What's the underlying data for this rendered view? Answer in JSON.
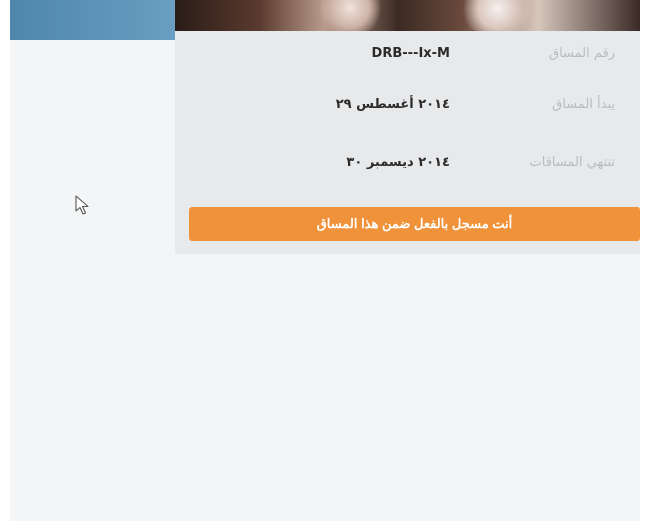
{
  "hero": {
    "image_alt": ""
  },
  "details": {
    "course_number_label": "رقم المساق",
    "course_number_value": "DRB---Ix-M",
    "start_label": "يبدأ المساق",
    "start_value": "٢٠١٤ أغسطس ٢٩",
    "end_label": "تنتهي المساقات",
    "end_value": "٢٠١٤ ديسمبر ٣٠"
  },
  "actions": {
    "registered_label": "أنت مسجل بالفعل ضمن هذا المساق"
  },
  "colors": {
    "accent": "#f0923a",
    "panel": "#e8e9eb",
    "background": "#f4f5f7",
    "label": "#b8bcc2",
    "band": "#5d93b8"
  },
  "icons": {
    "cursor": "mouse-pointer-icon"
  }
}
